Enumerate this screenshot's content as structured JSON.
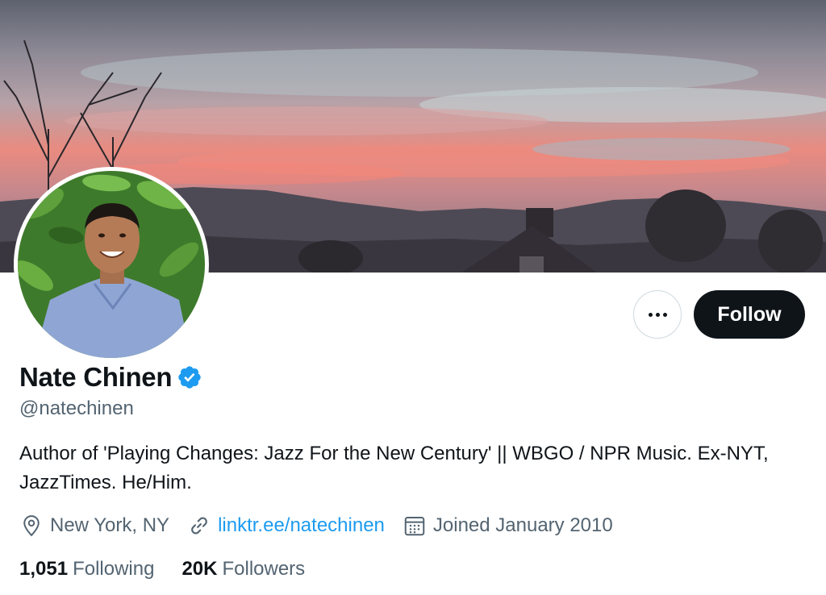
{
  "profile": {
    "display_name": "Nate Chinen",
    "handle": "@natechinen",
    "bio": "Author of 'Playing Changes: Jazz For the New Century' || WBGO / NPR Music. Ex-NYT, JazzTimes. He/Him.",
    "verified_icon": "verified-badge-icon",
    "verified_color": "#1d9bf0"
  },
  "actions": {
    "more_icon": "more-options-icon",
    "follow_label": "Follow"
  },
  "meta": {
    "location": "New York, NY",
    "location_icon": "location-pin-icon",
    "website": "linktr.ee/natechinen",
    "website_icon": "link-icon",
    "joined": "Joined January 2010",
    "joined_icon": "calendar-icon"
  },
  "stats": {
    "following_count": "1,051",
    "following_label": "Following",
    "followers_count": "20K",
    "followers_label": "Followers"
  },
  "colors": {
    "accent": "#1d9bf0",
    "text_primary": "#0f1419",
    "text_secondary": "#536471",
    "button_dark": "#0f1419"
  }
}
